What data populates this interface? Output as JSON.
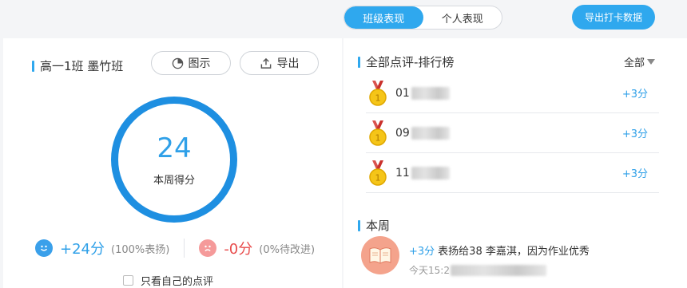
{
  "topbar": {
    "tabs": [
      {
        "label": "班级表现",
        "active": true
      },
      {
        "label": "个人表现",
        "active": false
      }
    ],
    "export_data_label": "导出打卡数据"
  },
  "left": {
    "class_title": "高一1班 墨竹班",
    "chart_button_label": "图示",
    "export_button_label": "导出",
    "score": "24",
    "score_label": "本周得分",
    "positive_points": "+24分",
    "positive_note": "(100%表扬)",
    "negative_points": "-0分",
    "negative_note": "(0%待改进)",
    "only_mine_label": "只看自己的点评"
  },
  "right": {
    "ranking_title": "全部点评-排行榜",
    "filter_label": "全部",
    "ranking": [
      {
        "prefix": "01",
        "points": "+3分"
      },
      {
        "prefix": "09",
        "points": "+3分"
      },
      {
        "prefix": "11",
        "points": "+3分"
      }
    ],
    "week_title": "本周",
    "week_item": {
      "points": "+3分",
      "text": "表扬给38 李嘉淇，因为作业优秀",
      "time_prefix": "今天15:2"
    }
  },
  "colors": {
    "accent": "#2fa8ee",
    "ring": "#1e8fe1",
    "negative": "#e84b4b",
    "medal_gold": "#f5c518",
    "medal_ribbon": "#d9534f"
  }
}
